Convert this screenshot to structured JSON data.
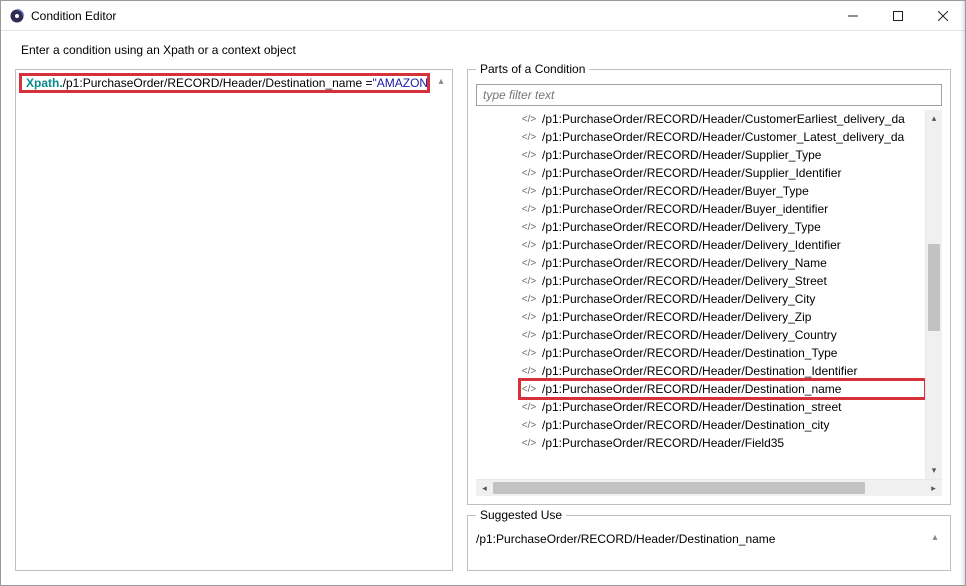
{
  "window": {
    "title": "Condition Editor"
  },
  "instruction": "Enter a condition using an Xpath or a context object",
  "xpath": {
    "keyword": "Xpath.",
    "path": "/p1:PurchaseOrder/RECORD/Header/Destination_name = ",
    "value": "\"AMAZON\""
  },
  "parts": {
    "label": "Parts of a Condition",
    "filter_placeholder": "type filter text",
    "items": [
      "/p1:PurchaseOrder/RECORD/Header/CustomerEarliest_delivery_da",
      "/p1:PurchaseOrder/RECORD/Header/Customer_Latest_delivery_da",
      "/p1:PurchaseOrder/RECORD/Header/Supplier_Type",
      "/p1:PurchaseOrder/RECORD/Header/Supplier_Identifier",
      "/p1:PurchaseOrder/RECORD/Header/Buyer_Type",
      "/p1:PurchaseOrder/RECORD/Header/Buyer_identifier",
      "/p1:PurchaseOrder/RECORD/Header/Delivery_Type",
      "/p1:PurchaseOrder/RECORD/Header/Delivery_Identifier",
      "/p1:PurchaseOrder/RECORD/Header/Delivery_Name",
      "/p1:PurchaseOrder/RECORD/Header/Delivery_Street",
      "/p1:PurchaseOrder/RECORD/Header/Delivery_City",
      "/p1:PurchaseOrder/RECORD/Header/Delivery_Zip",
      "/p1:PurchaseOrder/RECORD/Header/Delivery_Country",
      "/p1:PurchaseOrder/RECORD/Header/Destination_Type",
      "/p1:PurchaseOrder/RECORD/Header/Destination_Identifier",
      "/p1:PurchaseOrder/RECORD/Header/Destination_name",
      "/p1:PurchaseOrder/RECORD/Header/Destination_street",
      "/p1:PurchaseOrder/RECORD/Header/Destination_city",
      "/p1:PurchaseOrder/RECORD/Header/Field35"
    ],
    "highlighted_index": 15,
    "xml_icon_label": "</>"
  },
  "suggested": {
    "label": "Suggested Use",
    "text": "/p1:PurchaseOrder/RECORD/Header/Destination_name"
  },
  "icons": {
    "up": "▴",
    "down": "▾",
    "left": "◂",
    "right": "▸"
  },
  "colors": {
    "highlight_border": "#d6303a",
    "keyword": "#0b8a8a",
    "value": "#1a1aaa"
  }
}
